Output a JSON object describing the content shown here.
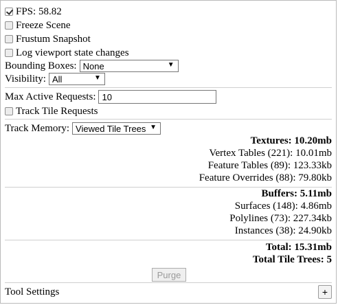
{
  "checkboxes": {
    "fps": {
      "label": "FPS: 58.82",
      "checked": true
    },
    "freeze": {
      "label": "Freeze Scene",
      "checked": false
    },
    "frustum": {
      "label": "Frustum Snapshot",
      "checked": false
    },
    "log_viewport": {
      "label": "Log viewport state changes",
      "checked": false
    },
    "track_tile": {
      "label": "Track Tile Requests",
      "checked": false
    }
  },
  "bounding_boxes": {
    "label": "Bounding Boxes:",
    "value": "None"
  },
  "visibility": {
    "label": "Visibility:",
    "value": "All"
  },
  "max_active": {
    "label": "Max Active Requests:",
    "value": "10"
  },
  "track_memory": {
    "label": "Track Memory:",
    "value": "Viewed Tile Trees"
  },
  "textures": {
    "header": "Textures: 10.20mb",
    "items": [
      "Vertex Tables (221): 10.01mb",
      "Feature Tables (89): 123.33kb",
      "Feature Overrides (88): 79.80kb"
    ]
  },
  "buffers": {
    "header": "Buffers: 5.11mb",
    "items": [
      "Surfaces (148): 4.86mb",
      "Polylines (73): 227.34kb",
      "Instances (38): 24.90kb"
    ]
  },
  "totals": {
    "total": "Total: 15.31mb",
    "tile_trees": "Total Tile Trees: 5"
  },
  "purge_label": "Purge",
  "tool_settings": {
    "label": "Tool Settings",
    "button": "+"
  },
  "icons": {
    "caret": "triangle-down",
    "check": "check-mark"
  }
}
